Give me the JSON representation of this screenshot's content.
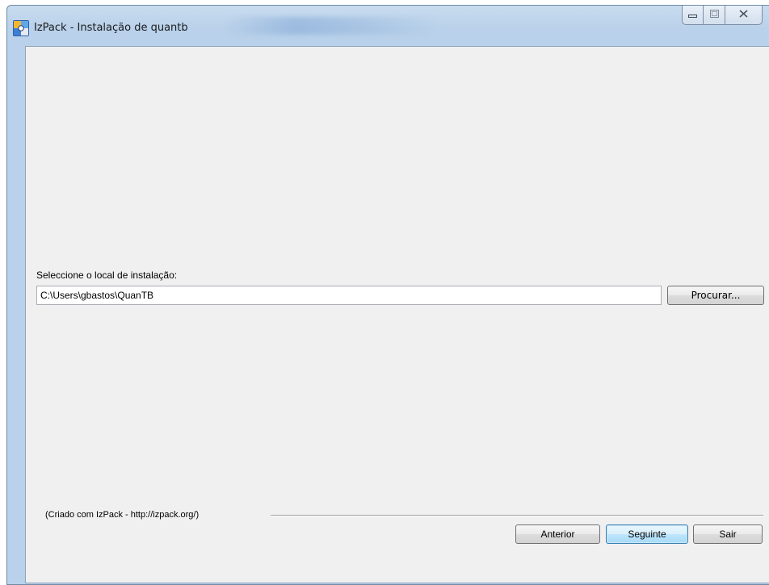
{
  "window": {
    "title": "IzPack - Instalação de quantb",
    "controls": {
      "minimize_icon": "minimize-icon",
      "maximize_icon": "maximize-icon",
      "close_icon": "close-icon"
    }
  },
  "panel": {
    "field_label": "Seleccione o local de instalação:",
    "install_path": "C:\\Users\\gbastos\\QuanTB",
    "browse_label": "Procurar..."
  },
  "footer": {
    "credit": "(Criado com IzPack - http://izpack.org/)",
    "previous_label": "Anterior",
    "next_label": "Seguinte",
    "exit_label": "Sair"
  },
  "colors": {
    "frame": "#b9d1ea",
    "client_bg": "#f0f0f0",
    "default_button_border": "#3c7fb1"
  }
}
